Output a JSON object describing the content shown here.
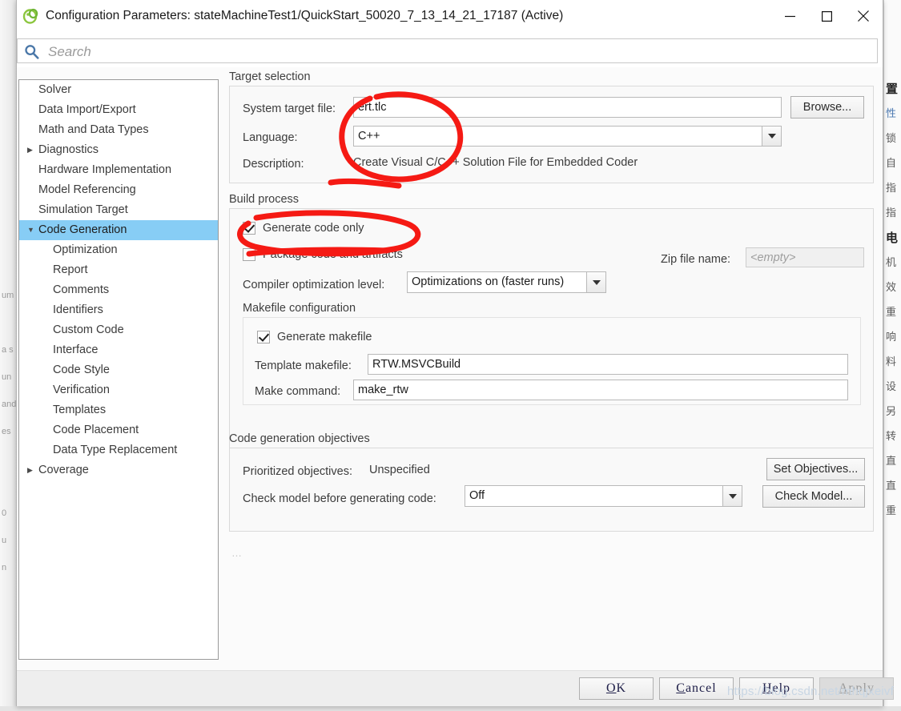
{
  "window": {
    "title": "Configuration Parameters: stateMachineTest1/QuickStart_50020_7_13_14_21_17187 (Active)",
    "app_icon": "matlab-simulink-icon",
    "minimize_label": "—",
    "maximize_label": "□",
    "close_label": "✕"
  },
  "search": {
    "placeholder": "Search",
    "value": "",
    "icon": "search-icon"
  },
  "tree": {
    "items": [
      {
        "label": "Solver",
        "level": 0,
        "arrow": "",
        "selected": false
      },
      {
        "label": "Data Import/Export",
        "level": 0,
        "arrow": "",
        "selected": false
      },
      {
        "label": "Math and Data Types",
        "level": 0,
        "arrow": "",
        "selected": false
      },
      {
        "label": "Diagnostics",
        "level": 0,
        "arrow": "▶",
        "selected": false
      },
      {
        "label": "Hardware Implementation",
        "level": 0,
        "arrow": "",
        "selected": false
      },
      {
        "label": "Model Referencing",
        "level": 0,
        "arrow": "",
        "selected": false
      },
      {
        "label": "Simulation Target",
        "level": 0,
        "arrow": "",
        "selected": false
      },
      {
        "label": "Code Generation",
        "level": 0,
        "arrow": "▼",
        "selected": true
      },
      {
        "label": "Optimization",
        "level": 1,
        "arrow": "",
        "selected": false
      },
      {
        "label": "Report",
        "level": 1,
        "arrow": "",
        "selected": false
      },
      {
        "label": "Comments",
        "level": 1,
        "arrow": "",
        "selected": false
      },
      {
        "label": "Identifiers",
        "level": 1,
        "arrow": "",
        "selected": false
      },
      {
        "label": "Custom Code",
        "level": 1,
        "arrow": "",
        "selected": false
      },
      {
        "label": "Interface",
        "level": 1,
        "arrow": "",
        "selected": false
      },
      {
        "label": "Code Style",
        "level": 1,
        "arrow": "",
        "selected": false
      },
      {
        "label": "Verification",
        "level": 1,
        "arrow": "",
        "selected": false
      },
      {
        "label": "Templates",
        "level": 1,
        "arrow": "",
        "selected": false
      },
      {
        "label": "Code Placement",
        "level": 1,
        "arrow": "",
        "selected": false
      },
      {
        "label": "Data Type Replacement",
        "level": 1,
        "arrow": "",
        "selected": false
      },
      {
        "label": "Coverage",
        "level": 0,
        "arrow": "▶",
        "selected": false
      }
    ]
  },
  "target_selection": {
    "group_title": "Target selection",
    "system_target_file_label": "System target file:",
    "system_target_file_value": "ert.tlc",
    "browse_label": "Browse...",
    "language_label": "Language:",
    "language_value": "C++",
    "description_label": "Description:",
    "description_value": "Create Visual C/C++ Solution File for Embedded Coder"
  },
  "build_process": {
    "group_title": "Build process",
    "generate_code_only_label": "Generate code only",
    "generate_code_only_checked": true,
    "package_code_label": "Package code and artifacts",
    "package_code_checked": false,
    "zip_file_label": "Zip file name:",
    "zip_file_value": "<empty>",
    "compiler_opt_label": "Compiler optimization level:",
    "compiler_opt_value": "Optimizations on (faster runs)",
    "makefile": {
      "group_title": "Makefile configuration",
      "generate_makefile_label": "Generate makefile",
      "generate_makefile_checked": true,
      "template_makefile_label": "Template makefile:",
      "template_makefile_value": "RTW.MSVCBuild",
      "make_command_label": "Make command:",
      "make_command_value": "make_rtw"
    }
  },
  "code_gen_objectives": {
    "group_title": "Code generation objectives",
    "prioritized_label": "Prioritized objectives:",
    "prioritized_value": "Unspecified",
    "set_objectives_label": "Set Objectives...",
    "check_model_label": "Check model before generating code:",
    "check_model_value": "Off",
    "check_model_button_label": "Check Model...",
    "more_indicator": "…"
  },
  "footer": {
    "ok_mnem": "O",
    "ok_rest": "K",
    "cancel_mnem": "C",
    "cancel_rest": "ancel",
    "help_mnem": "H",
    "help_rest": "elp",
    "apply_mnem": "A",
    "apply_rest": "pply",
    "apply_disabled": true
  },
  "watermark": {
    "text": "https://blog.csdn.net/mhqjxeivf"
  },
  "background": {
    "right_column": [
      {
        "text": "置",
        "style": "bold"
      },
      {
        "text": "性",
        "style": "blue"
      },
      {
        "text": "锁",
        "style": ""
      },
      {
        "text": "自",
        "style": ""
      },
      {
        "text": "指",
        "style": ""
      },
      {
        "text": "指",
        "style": ""
      },
      {
        "text": "电",
        "style": "bold"
      },
      {
        "text": "机",
        "style": ""
      },
      {
        "text": "效",
        "style": ""
      },
      {
        "text": "重",
        "style": ""
      },
      {
        "text": "响",
        "style": ""
      },
      {
        "text": "料",
        "style": ""
      },
      {
        "text": "设",
        "style": ""
      },
      {
        "text": "另",
        "style": ""
      },
      {
        "text": "转",
        "style": ""
      },
      {
        "text": "直",
        "style": ""
      },
      {
        "text": "直",
        "style": ""
      },
      {
        "text": "重",
        "style": ""
      }
    ],
    "left_column": [
      {
        "text": ""
      },
      {
        "text": ""
      },
      {
        "text": ""
      },
      {
        "text": "um"
      },
      {
        "text": ""
      },
      {
        "text": "a s"
      },
      {
        "text": "un"
      },
      {
        "text": "and"
      },
      {
        "text": "es"
      },
      {
        "text": ""
      },
      {
        "text": ""
      },
      {
        "text": "0"
      },
      {
        "text": "u"
      },
      {
        "text": "n"
      }
    ]
  },
  "colors": {
    "selection_blue": "#87cdf5",
    "annotation_red": "#f51a14",
    "search_icon_blue": "#4a77a8",
    "app_icon_green": "#7ac143"
  }
}
